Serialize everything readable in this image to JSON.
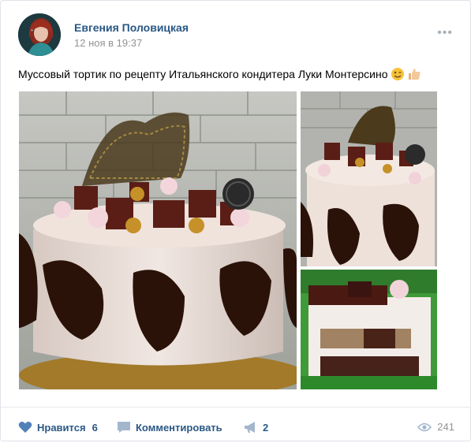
{
  "post": {
    "author": "Евгения Половицкая",
    "date": "12 ноя в 19:37",
    "more_icon": "more-dots-icon",
    "text": "Муссовый тортик по рецепту Итальянского кондитера Луки Монтерсино",
    "emojis": [
      "winking-face-icon",
      "thumbs-up-icon"
    ]
  },
  "footer": {
    "like_label": "Нравится",
    "like_count": "6",
    "comment_label": "Комментировать",
    "share_count": "2",
    "views_count": "241"
  },
  "colors": {
    "link": "#2a5885",
    "muted": "#939393",
    "icon": "#5181b8"
  }
}
